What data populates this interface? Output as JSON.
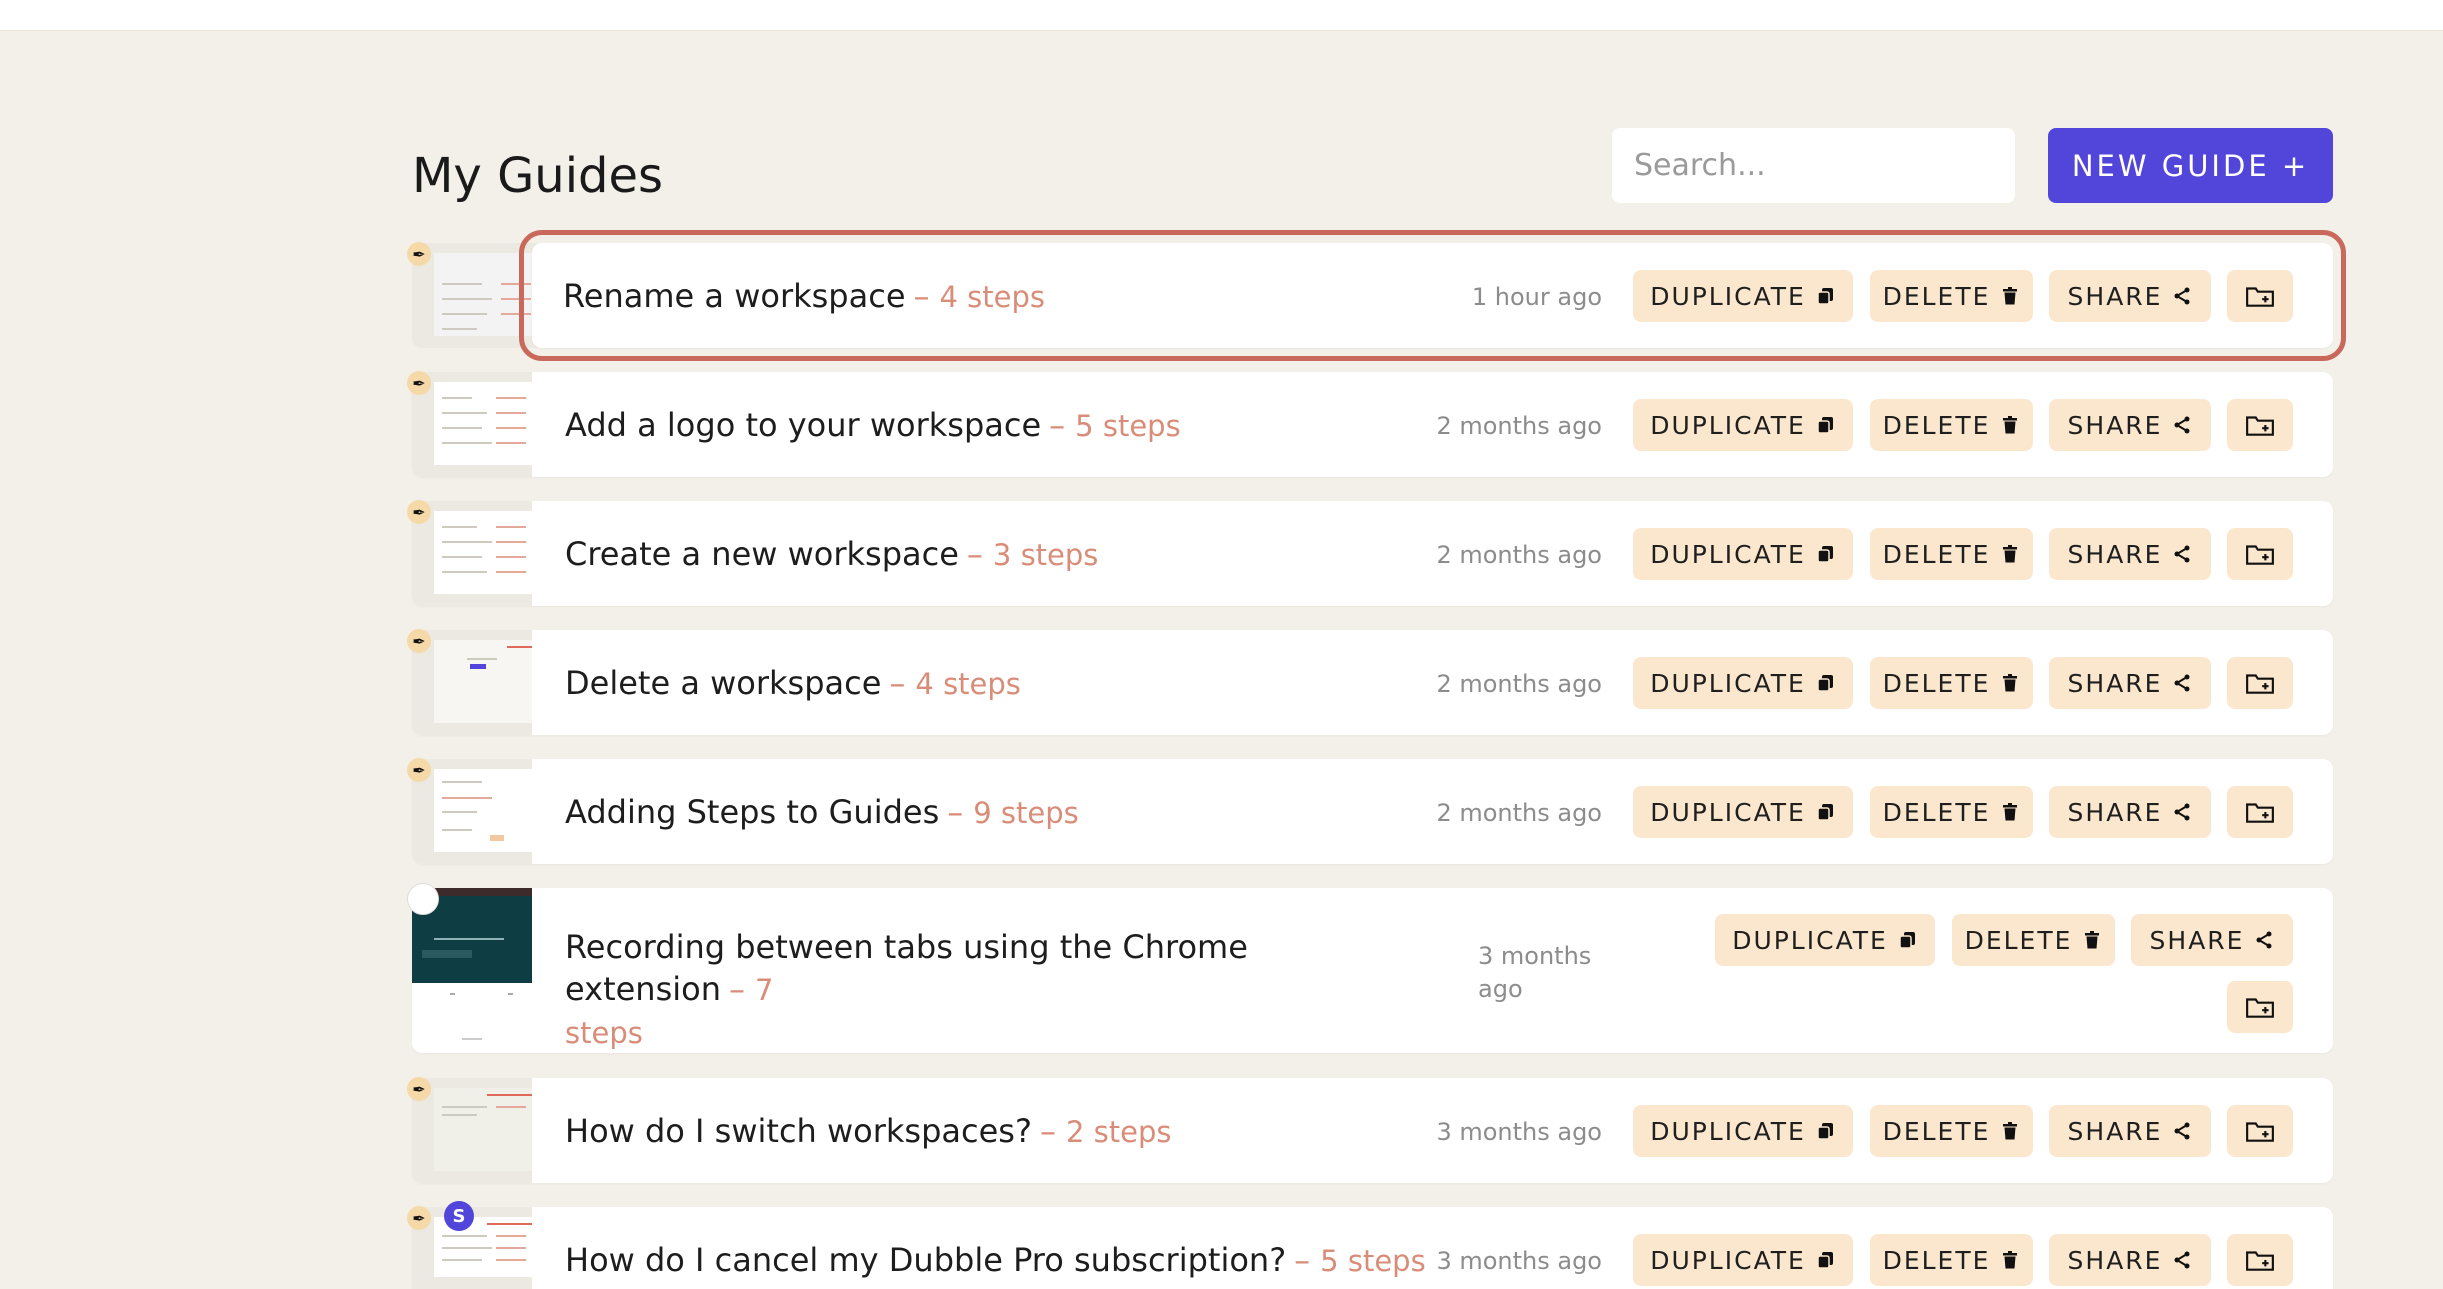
{
  "header": {
    "title": "My Guides",
    "search_placeholder": "Search...",
    "new_guide_label": "NEW GUIDE +"
  },
  "actions": {
    "duplicate": "DUPLICATE",
    "delete": "DELETE",
    "share": "SHARE"
  },
  "icons": {
    "duplicate": "copy-icon",
    "delete": "trash-icon",
    "share": "share-icon",
    "folder": "folder-plus-icon",
    "badge": "wand-icon",
    "avatar": "avatar-s"
  },
  "colors": {
    "primary": "#5146d9",
    "action_bg": "#fbe7cd",
    "steps_text": "#d98d78",
    "highlight_outline": "#c9695c",
    "page_bg": "#f3f0e9"
  },
  "guides": [
    {
      "title": "Rename a workspace",
      "steps": "4 steps",
      "time": "1 hour ago",
      "highlighted": true
    },
    {
      "title": "Add a logo to your workspace",
      "steps": "5 steps",
      "time": "2 months ago"
    },
    {
      "title": "Create a new workspace",
      "steps": "3 steps",
      "time": "2 months ago"
    },
    {
      "title": "Delete a workspace",
      "steps": "4 steps",
      "time": "2 months ago"
    },
    {
      "title": "Adding Steps to Guides",
      "steps": "9 steps",
      "time": "2 months ago"
    },
    {
      "title": "Recording between tabs using the Chrome extension",
      "steps_part1": "7",
      "steps_part2": "steps",
      "time_part1": "3 months",
      "time_part2": "ago"
    },
    {
      "title": "How do I switch workspaces?",
      "steps": "2 steps",
      "time": "3 months ago"
    },
    {
      "title": "How do I cancel my Dubble Pro subscription?",
      "steps": "5 steps",
      "time": "3 months ago",
      "avatar": "S"
    }
  ]
}
